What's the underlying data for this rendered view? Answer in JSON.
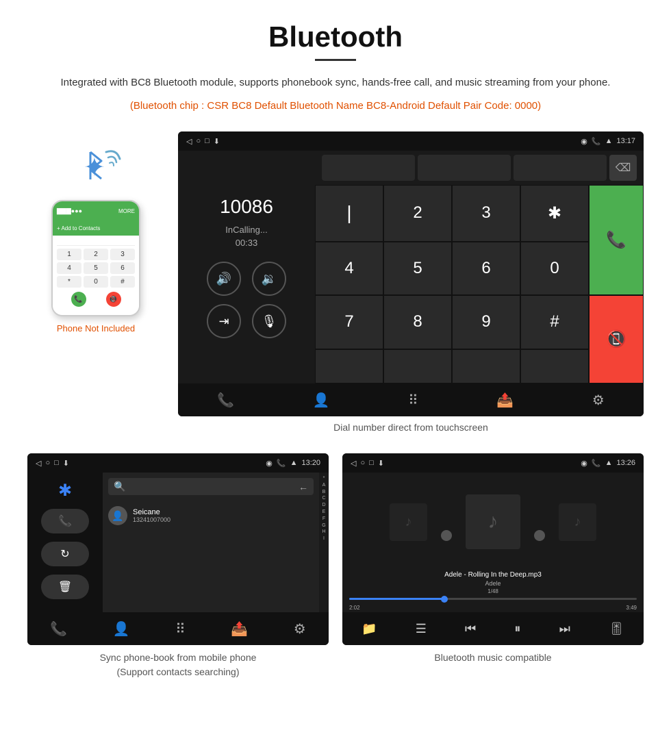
{
  "title": "Bluetooth",
  "description": "Integrated with BC8 Bluetooth module, supports phonebook sync, hands-free call, and music streaming from your phone.",
  "bluetooth_info": "(Bluetooth chip : CSR BC8    Default Bluetooth Name BC8-Android    Default Pair Code: 0000)",
  "phone_not_included": "Phone Not Included",
  "section1": {
    "caption": "Dial number direct from touchscreen",
    "dial_number": "10086",
    "status": "InCalling...",
    "timer": "00:33",
    "keypad": [
      "1",
      "2",
      "3",
      "*",
      "4",
      "5",
      "6",
      "0",
      "7",
      "8",
      "9",
      "#"
    ],
    "time": "13:17"
  },
  "section2": {
    "phonebook": {
      "caption_line1": "Sync phone-book from mobile phone",
      "caption_line2": "(Support contacts searching)",
      "contact_name": "Seicane",
      "contact_phone": "13241007000",
      "alphabet": [
        "*",
        "A",
        "B",
        "C",
        "D",
        "E",
        "F",
        "G",
        "H",
        "I"
      ],
      "time": "13:20"
    },
    "music": {
      "caption": "Bluetooth music compatible",
      "title": "Adele - Rolling In the Deep.mp3",
      "artist": "Adele",
      "track_info": "1/48",
      "time_current": "2:02",
      "time_total": "3:49",
      "time": "13:26"
    }
  },
  "status_icons": {
    "back": "◁",
    "home": "○",
    "recent": "□",
    "download": "⬇",
    "location": "◉",
    "phone": "📞",
    "signal": "▲",
    "battery": "▮"
  }
}
